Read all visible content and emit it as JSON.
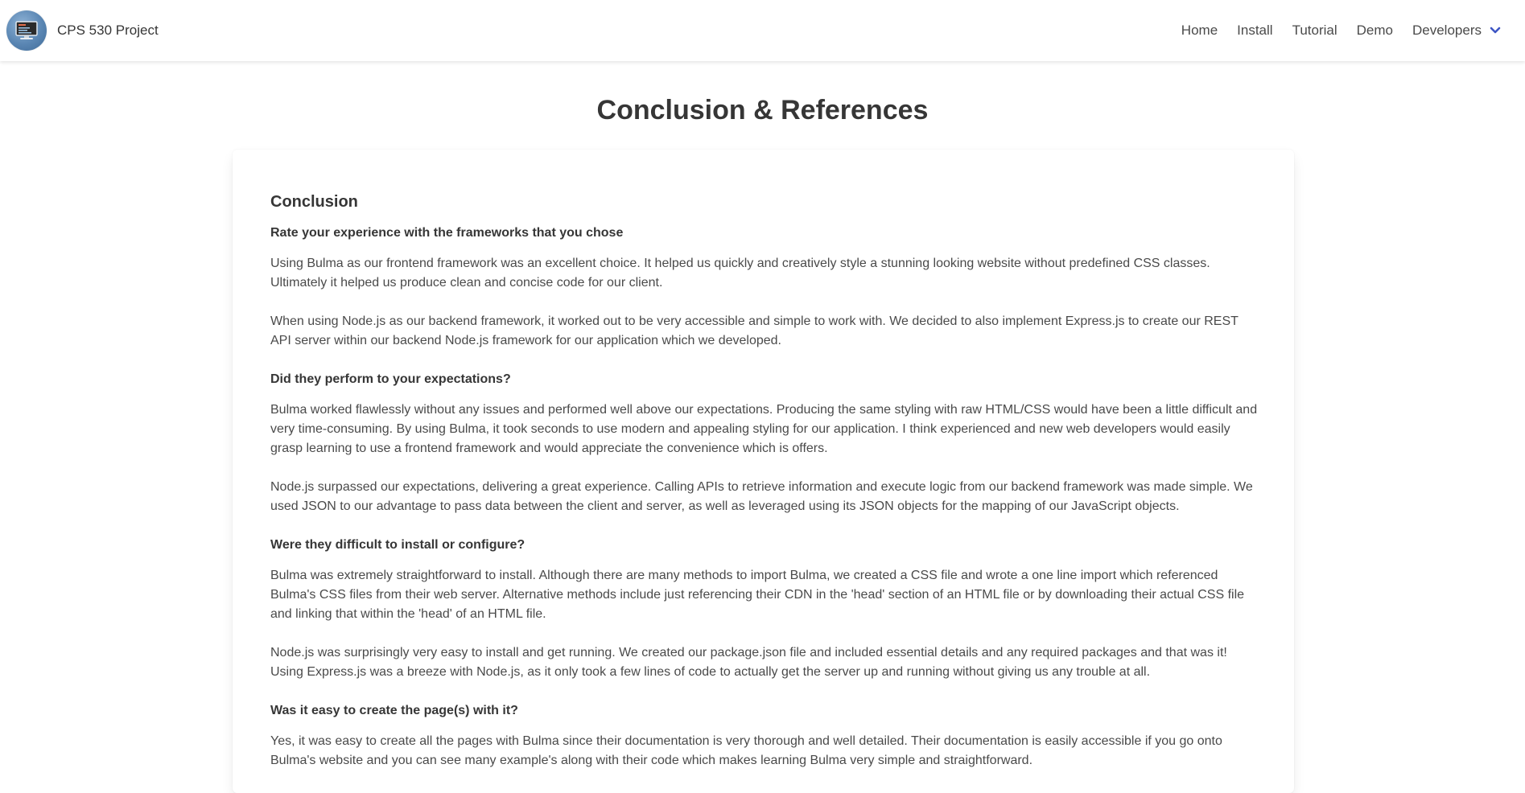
{
  "navbar": {
    "brand_title": "CPS 530 Project",
    "items": [
      {
        "label": "Home"
      },
      {
        "label": "Install"
      },
      {
        "label": "Tutorial"
      },
      {
        "label": "Demo"
      },
      {
        "label": "Developers"
      }
    ],
    "accent_color": "#3e56c4"
  },
  "page": {
    "title": "Conclusion & References"
  },
  "conclusion": {
    "heading": "Conclusion",
    "qa": [
      {
        "question": "Rate your experience with the frameworks that you chose",
        "paragraphs": [
          "Using Bulma as our frontend framework was an excellent choice. It helped us quickly and creatively style a stunning looking website without predefined CSS classes. Ultimately it helped us produce clean and concise code for our client.",
          "When using Node.js as our backend framework, it worked out to be very accessible and simple to work with. We decided to also implement Express.js to create our REST API server within our backend Node.js framework for our application which we developed."
        ]
      },
      {
        "question": "Did they perform to your expectations?",
        "paragraphs": [
          "Bulma worked flawlessly without any issues and performed well above our expectations. Producing the same styling with raw HTML/CSS would have been a little difficult and very time-consuming. By using Bulma, it took seconds to use modern and appealing styling for our application. I think experienced and new web developers would easily grasp learning to use a frontend framework and would appreciate the convenience which is offers.",
          "Node.js surpassed our expectations, delivering a great experience. Calling APIs to retrieve information and execute logic from our backend framework was made simple. We used JSON to our advantage to pass data between the client and server, as well as leveraged using its JSON objects for the mapping of our JavaScript objects."
        ]
      },
      {
        "question": "Were they difficult to install or configure?",
        "paragraphs": [
          "Bulma was extremely straightforward to install. Although there are many methods to import Bulma, we created a CSS file and wrote a one line import which referenced Bulma's CSS files from their web server. Alternative methods include just referencing their CDN in the 'head' section of an HTML file or by downloading their actual CSS file and linking that within the 'head' of an HTML file.",
          "Node.js was surprisingly very easy to install and get running. We created our package.json file and included essential details and any required packages and that was it! Using Express.js was a breeze with Node.js, as it only took a few lines of code to actually get the server up and running without giving us any trouble at all."
        ]
      },
      {
        "question": "Was it easy to create the page(s) with it?",
        "paragraphs": [
          "Yes, it was easy to create all the pages with Bulma since their documentation is very thorough and well detailed. Their documentation is easily accessible if you go onto Bulma's website and you can see many example's along with their code which makes learning Bulma very simple and straightforward."
        ]
      }
    ]
  }
}
